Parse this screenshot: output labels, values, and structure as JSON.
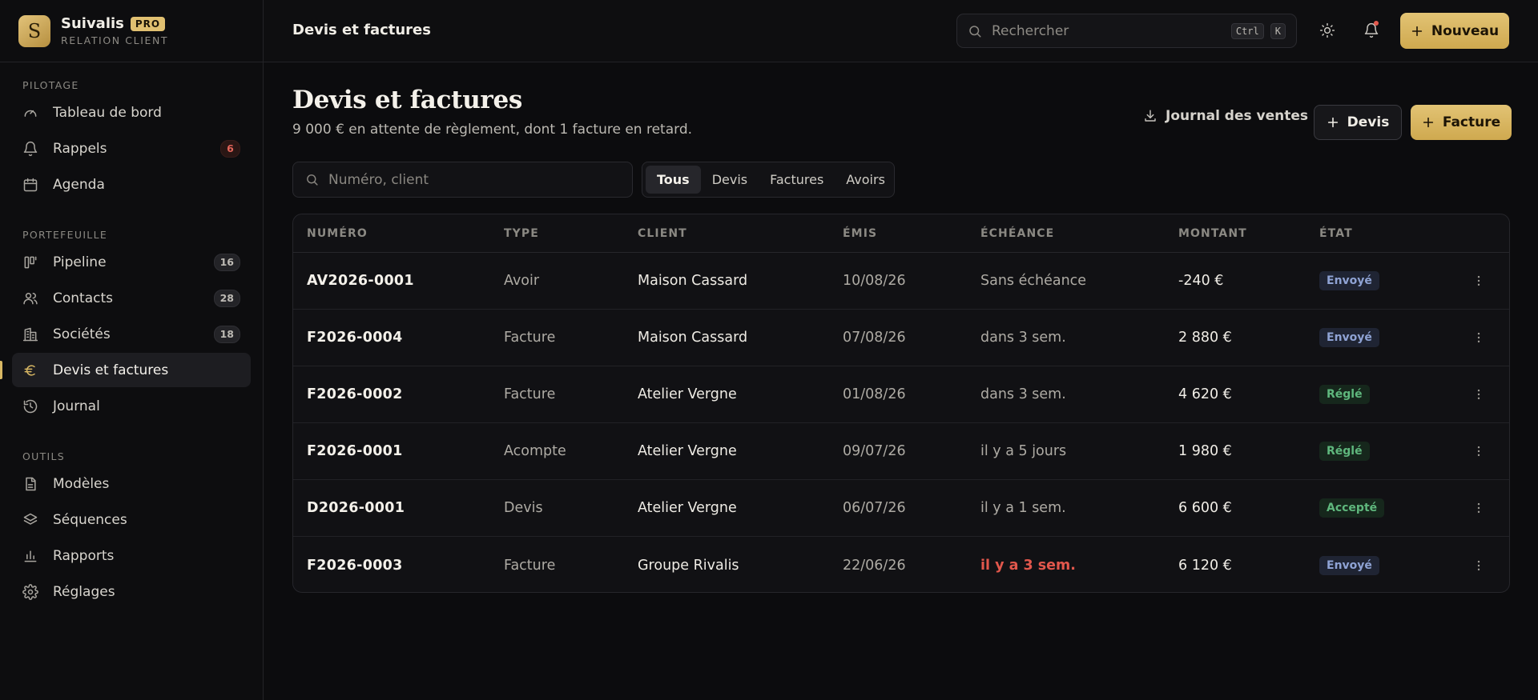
{
  "brand": {
    "logo_letter": "S",
    "name": "Suivalis",
    "tier": "PRO",
    "subtitle": "RELATION CLIENT"
  },
  "sidebar": {
    "sections": [
      {
        "heading": "PILOTAGE",
        "items": [
          {
            "label": "Tableau de bord",
            "icon": "gauge-icon"
          },
          {
            "label": "Rappels",
            "icon": "bell-icon",
            "count": "6"
          },
          {
            "label": "Agenda",
            "icon": "calendar-icon"
          }
        ]
      },
      {
        "heading": "PORTEFEUILLE",
        "items": [
          {
            "label": "Pipeline",
            "icon": "kanban-icon",
            "count": "16"
          },
          {
            "label": "Contacts",
            "icon": "users-icon",
            "count": "28"
          },
          {
            "label": "Sociétés",
            "icon": "building-icon",
            "count": "18"
          },
          {
            "label": "Devis et factures",
            "icon": "euro-icon",
            "active": true
          },
          {
            "label": "Journal",
            "icon": "history-icon"
          }
        ]
      },
      {
        "heading": "OUTILS",
        "items": [
          {
            "label": "Modèles",
            "icon": "file-text-icon"
          },
          {
            "label": "Séquences",
            "icon": "layers-icon"
          },
          {
            "label": "Rapports",
            "icon": "bar-chart-icon"
          },
          {
            "label": "Réglages",
            "icon": "gear-icon"
          }
        ]
      }
    ]
  },
  "topbar": {
    "title": "Devis et factures",
    "search_placeholder": "Rechercher",
    "shortcut": [
      "Ctrl",
      "K"
    ],
    "new_label": "Nouveau"
  },
  "page": {
    "title": "Devis et factures",
    "subtitle": "9 000 € en attente de règlement, dont 1 facture en retard.",
    "journal_label": "Journal des ventes",
    "devis_label": "Devis",
    "facture_label": "Facture"
  },
  "filter": {
    "placeholder": "Numéro, client",
    "tabs": [
      "Tous",
      "Devis",
      "Factures",
      "Avoirs"
    ],
    "active_tab": "Tous"
  },
  "table": {
    "columns": [
      "NUMÉRO",
      "TYPE",
      "CLIENT",
      "ÉMIS",
      "ÉCHÉANCE",
      "MONTANT",
      "ÉTAT"
    ],
    "rows": [
      {
        "numero": "AV2026-0001",
        "type": "Avoir",
        "client": "Maison Cassard",
        "emis": "10/08/26",
        "echeance": "Sans échéance",
        "montant": "-240 €",
        "etat": "Envoyé",
        "status": "sent",
        "late": false
      },
      {
        "numero": "F2026-0004",
        "type": "Facture",
        "client": "Maison Cassard",
        "emis": "07/08/26",
        "echeance": "dans 3 sem.",
        "montant": "2 880 €",
        "etat": "Envoyé",
        "status": "sent",
        "late": false
      },
      {
        "numero": "F2026-0002",
        "type": "Facture",
        "client": "Atelier Vergne",
        "emis": "01/08/26",
        "echeance": "dans 3 sem.",
        "montant": "4 620 €",
        "etat": "Réglé",
        "status": "paid",
        "late": false
      },
      {
        "numero": "F2026-0001",
        "type": "Acompte",
        "client": "Atelier Vergne",
        "emis": "09/07/26",
        "echeance": "il y a 5 jours",
        "montant": "1 980 €",
        "etat": "Réglé",
        "status": "paid",
        "late": false
      },
      {
        "numero": "D2026-0001",
        "type": "Devis",
        "client": "Atelier Vergne",
        "emis": "06/07/26",
        "echeance": "il y a 1 sem.",
        "montant": "6 600 €",
        "etat": "Accepté",
        "status": "accepted",
        "late": false
      },
      {
        "numero": "F2026-0003",
        "type": "Facture",
        "client": "Groupe Rivalis",
        "emis": "22/06/26",
        "echeance": "il y a 3 sem.",
        "montant": "6 120 €",
        "etat": "Envoyé",
        "status": "sent",
        "late": true
      }
    ]
  },
  "colors": {
    "accent": "#d9b864",
    "late": "#e2574c",
    "sent": "#8fa3d4",
    "paid": "#5fb77d"
  }
}
